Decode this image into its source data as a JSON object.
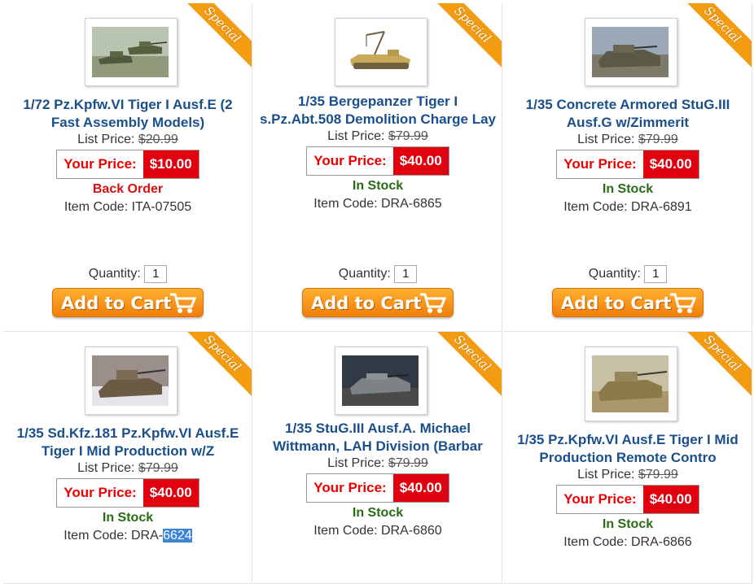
{
  "labels": {
    "list_price": "List Price:",
    "your_price": "Your Price:",
    "item_code": "Item Code:",
    "quantity": "Quantity:",
    "add_to_cart": "Add to Cart",
    "special": "Special"
  },
  "products": [
    {
      "title": "1/72 Pz.Kpfw.VI Tiger I Ausf.E (2 Fast Assembly Models)",
      "list_price": "$20.99",
      "your_price": "$10.00",
      "availability": "Back Order",
      "item_code": "ITA-07505",
      "quantity": "1",
      "image": "tiger-tanks-pair-photo"
    },
    {
      "title": "1/35 Bergepanzer Tiger I s.Pz.Abt.508 Demolition Charge Lay",
      "list_price": "$79.99",
      "your_price": "$40.00",
      "availability": "In Stock",
      "item_code": "DRA-6865",
      "quantity": "1",
      "image": "bergepanzer-crane-photo"
    },
    {
      "title": "1/35 Concrete Armored StuG.III Ausf.G w/Zimmerit",
      "list_price": "$79.99",
      "your_price": "$40.00",
      "availability": "In Stock",
      "item_code": "DRA-6891",
      "quantity": "1",
      "image": "stug-concrete-photo"
    },
    {
      "title": "1/35 Sd.Kfz.181 Pz.Kpfw.VI Ausf.E Tiger I Mid Production w/Z",
      "list_price": "$79.99",
      "your_price": "$40.00",
      "availability": "In Stock",
      "item_code_prefix": "DRA-",
      "item_code_selected": "6624",
      "image": "tiger-winter-photo"
    },
    {
      "title": "1/35 StuG.III Ausf.A. Michael Wittmann, LAH Division (Barbar",
      "list_price": "$79.99",
      "your_price": "$40.00",
      "availability": "In Stock",
      "item_code": "DRA-6860",
      "image": "stug-grey-photo"
    },
    {
      "title": "1/35 Pz.Kpfw.VI Ausf.E Tiger I Mid Production Remote Contro",
      "list_price": "$79.99",
      "your_price": "$40.00",
      "availability": "In Stock",
      "item_code": "DRA-6866",
      "image": "tiger-desert-photo"
    }
  ],
  "colors": {
    "title_blue": "#1a4f8c",
    "price_red": "#e00010",
    "in_stock_green": "#2a6b16",
    "back_order_red": "#d41010",
    "special_orange": "#f39c12",
    "cart_orange": "#f39014"
  }
}
